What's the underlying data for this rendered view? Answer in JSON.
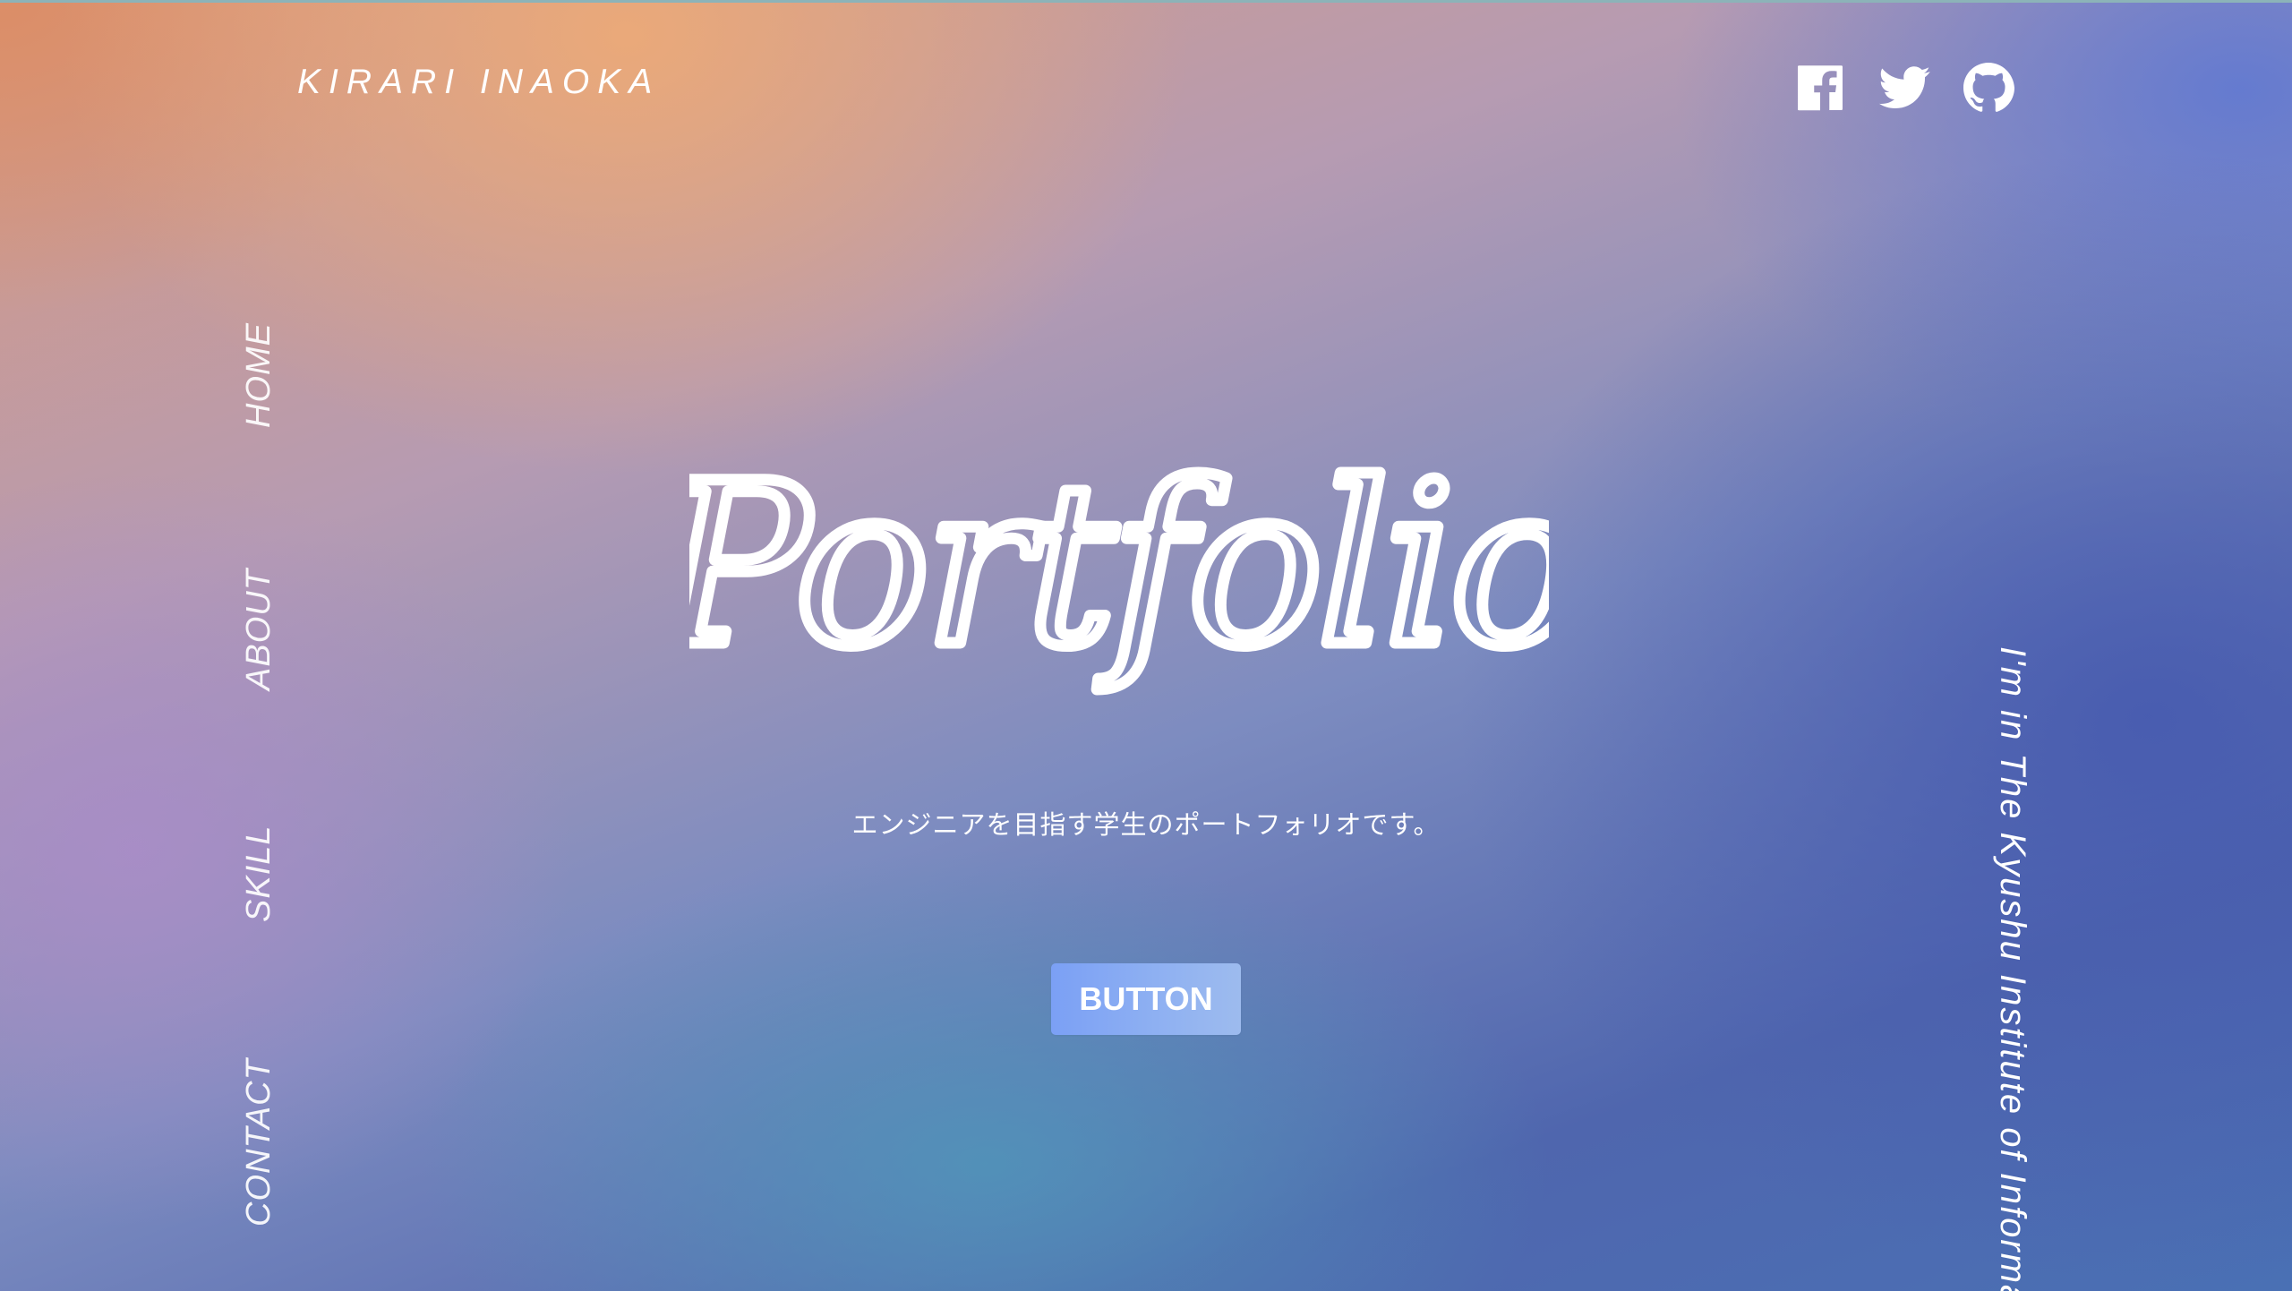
{
  "header": {
    "brand": "KIRARI INAOKA",
    "social": [
      {
        "name": "facebook",
        "icon": "facebook-icon"
      },
      {
        "name": "twitter",
        "icon": "twitter-icon"
      },
      {
        "name": "github",
        "icon": "github-icon"
      }
    ]
  },
  "nav": {
    "items": [
      {
        "label": "HOME"
      },
      {
        "label": "ABOUT"
      },
      {
        "label": "SKILL"
      },
      {
        "label": "CONTACT"
      }
    ]
  },
  "hero": {
    "title": "Portfolio",
    "subtitle": "エンジニアを目指す学生のポートフォリオです。",
    "button_label": "BUTTON"
  },
  "side_text": "I'm in The Kyushu Institute of Informa",
  "colors": {
    "text": "#ffffff",
    "button_start": "#7ba0f5",
    "button_end": "#9dbbee",
    "gradient_warm": "#e8a878",
    "gradient_cool": "#4f66ae"
  }
}
